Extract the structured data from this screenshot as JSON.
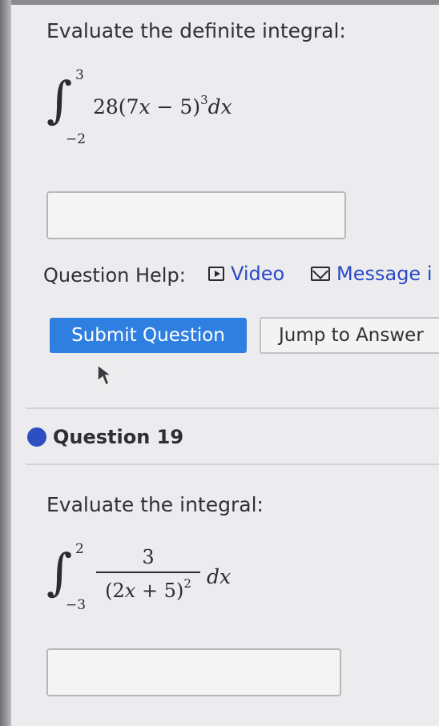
{
  "question1": {
    "prompt": "Evaluate the definite integral:",
    "upper_limit": "3",
    "lower_limit": "−2",
    "coefficient": "28(7",
    "var_x": "x",
    "minus_part": " − 5)",
    "exponent": "3",
    "differential": "dx"
  },
  "question_help": {
    "label": "Question Help:",
    "video_label": "Video",
    "message_label": "Message i"
  },
  "buttons": {
    "submit": "Submit Question",
    "jump": "Jump to Answer"
  },
  "question19": {
    "title": "Question 19",
    "prompt": "Evaluate the integral:",
    "upper_limit": "2",
    "lower_limit": "−3",
    "numerator": "3",
    "denominator_open": "(2",
    "var_x": "x",
    "denominator_rest": " + 5)",
    "exponent": "2",
    "differential": "dx"
  },
  "colors": {
    "accent": "#2f7fe0",
    "link": "#2a49c4",
    "question_dot": "#2d4fc2"
  }
}
